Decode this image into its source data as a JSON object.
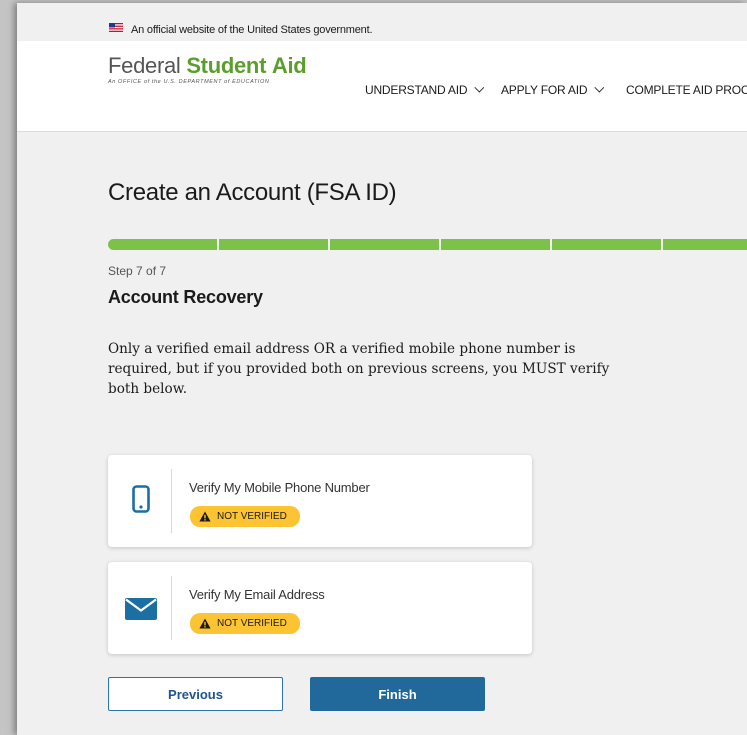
{
  "gov_banner": {
    "text": "An official website of the United States government."
  },
  "header": {
    "logo": {
      "word1": "Federal",
      "word2": "Student",
      "word3": "Aid",
      "subtitle": "An OFFICE of the U.S. DEPARTMENT of EDUCATION"
    },
    "nav": [
      {
        "label": "UNDERSTAND AID"
      },
      {
        "label": "APPLY FOR AID"
      },
      {
        "label": "COMPLETE AID PROCES"
      }
    ]
  },
  "main": {
    "page_title": "Create an Account (FSA ID)",
    "progress": {
      "current_step": 7,
      "total_steps": 7,
      "fraction_complete": 1.0
    },
    "step_label": "Step 7 of 7",
    "section_title": "Account Recovery",
    "description": "Only a verified email address OR a verified mobile phone number is required, but if you provided both on previous screens, you MUST verify both below.",
    "cards": [
      {
        "label": "Verify My Mobile Phone Number",
        "status": "NOT VERIFIED",
        "icon": "mobile-phone-icon"
      },
      {
        "label": "Verify My Email Address",
        "status": "NOT VERIFIED",
        "icon": "envelope-icon"
      }
    ],
    "buttons": {
      "previous": "Previous",
      "finish": "Finish"
    }
  },
  "colors": {
    "brand_green": "#5b9e2d",
    "progress_green": "#7cc14a",
    "accent_blue": "#22699b",
    "warning_yellow": "#fcc332"
  }
}
